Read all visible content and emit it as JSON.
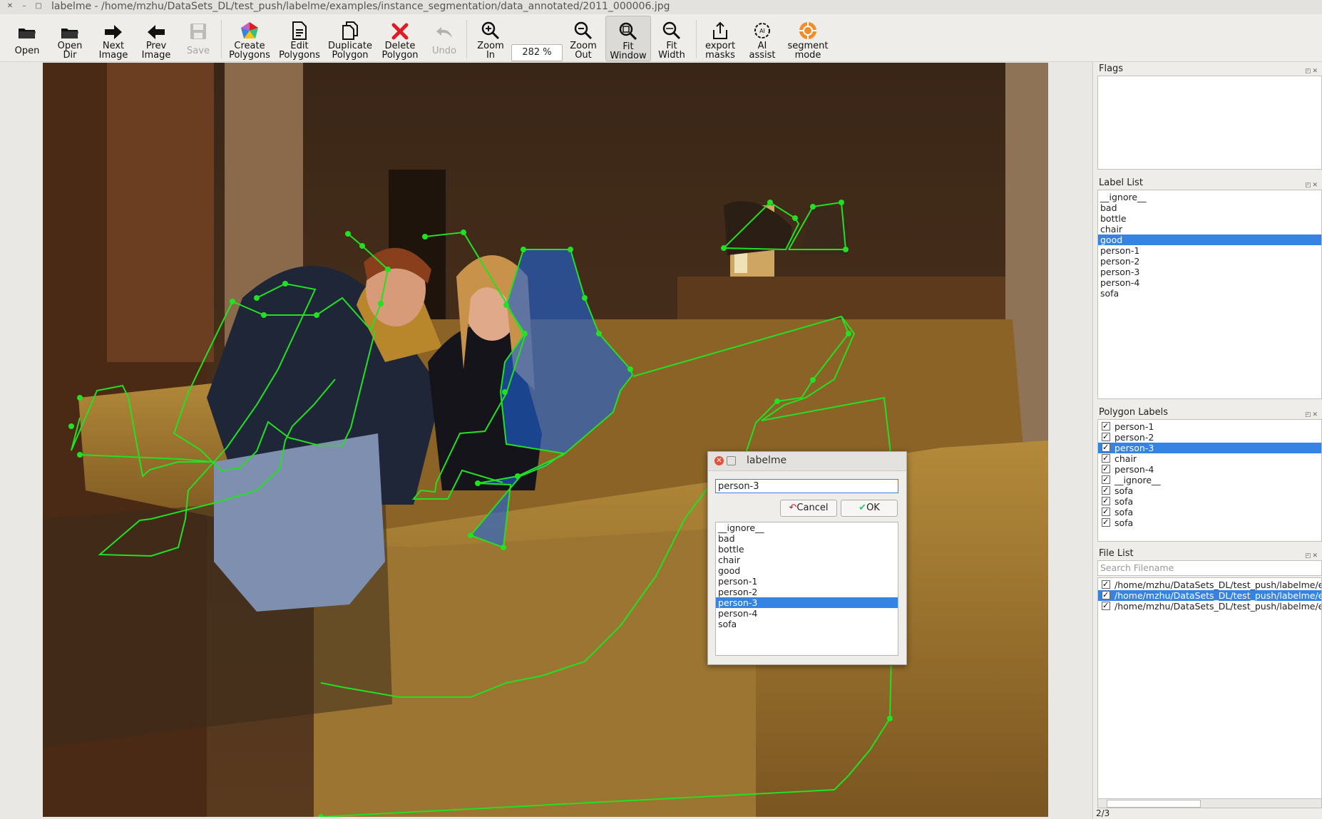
{
  "window": {
    "title": "labelme - /home/mzhu/DataSets_DL/test_push/labelme/examples/instance_segmentation/data_annotated/2011_000006.jpg"
  },
  "toolbar": {
    "open": "Open",
    "open_dir": [
      "Open",
      "Dir"
    ],
    "next_image": [
      "Next",
      "Image"
    ],
    "prev_image": [
      "Prev",
      "Image"
    ],
    "save": "Save",
    "create_polygons": [
      "Create",
      "Polygons"
    ],
    "edit_polygons": [
      "Edit",
      "Polygons"
    ],
    "duplicate_polygon": [
      "Duplicate",
      "Polygon"
    ],
    "delete_polygon": [
      "Delete",
      "Polygon"
    ],
    "undo": "Undo",
    "zoom_in": [
      "Zoom",
      "In"
    ],
    "zoom_value": "282 %",
    "zoom_out": [
      "Zoom",
      "Out"
    ],
    "fit_window": [
      "Fit",
      "Window"
    ],
    "fit_width": [
      "Fit",
      "Width"
    ],
    "export_masks": [
      "export",
      "masks"
    ],
    "ai_assist": [
      "AI",
      "assist"
    ],
    "segment_mode": [
      "segment",
      "mode"
    ]
  },
  "docks": {
    "flags": {
      "title": "Flags"
    },
    "label_list": {
      "title": "Label List",
      "items": [
        "__ignore__",
        "bad",
        "bottle",
        "chair",
        "good",
        "person-1",
        "person-2",
        "person-3",
        "person-4",
        "sofa"
      ],
      "selected": "good"
    },
    "polygon_labels": {
      "title": "Polygon Labels",
      "items": [
        "person-1",
        "person-2",
        "person-3",
        "chair",
        "person-4",
        "__ignore__",
        "sofa",
        "sofa",
        "sofa",
        "sofa"
      ],
      "selected": "person-3"
    },
    "file_list": {
      "title": "File List",
      "search_placeholder": "Search Filename",
      "items": [
        "/home/mzhu/DataSets_DL/test_push/labelme/exa",
        "/home/mzhu/DataSets_DL/test_push/labelme/exa",
        "/home/mzhu/DataSets_DL/test_push/labelme/exa"
      ],
      "selected_index": 1
    }
  },
  "dialog": {
    "title": "labelme",
    "input_value": "person-3",
    "cancel": "Cancel",
    "ok": "OK",
    "options": [
      "__ignore__",
      "bad",
      "bottle",
      "chair",
      "good",
      "person-1",
      "person-2",
      "person-3",
      "person-4",
      "sofa"
    ],
    "selected": "person-3"
  },
  "status": {
    "page": "2/3"
  },
  "colors": {
    "polygon_line": "#22e022",
    "polygon_fill_selected": "#1f63d6",
    "selection": "#3584e4",
    "delete_icon": "#e01b24"
  }
}
